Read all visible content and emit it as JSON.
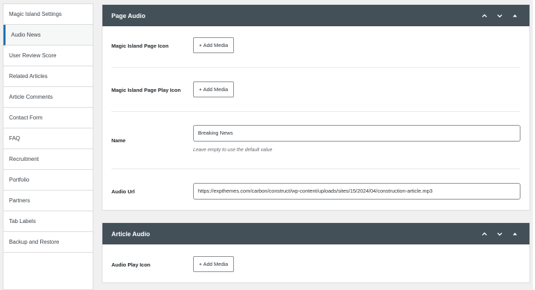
{
  "sidebar": {
    "items": [
      {
        "label": "Magic Island Settings"
      },
      {
        "label": "Audio News"
      },
      {
        "label": "User Review Score"
      },
      {
        "label": "Related Articles"
      },
      {
        "label": "Article Comments"
      },
      {
        "label": "Contact Form"
      },
      {
        "label": "FAQ"
      },
      {
        "label": "Recruitment"
      },
      {
        "label": "Portfolio"
      },
      {
        "label": "Partners"
      },
      {
        "label": "Tab Labels"
      },
      {
        "label": "Backup and Restore"
      }
    ],
    "active_index": 1
  },
  "page_audio": {
    "title": "Page Audio",
    "icons": [
      "chevron-up-icon",
      "chevron-down-icon",
      "triangle-up-icon"
    ],
    "fields": {
      "page_icon": {
        "label": "Magic Island Page Icon",
        "button": "+ Add Media"
      },
      "page_play_icon": {
        "label": "Magic Island Page Play Icon",
        "button": "+ Add Media"
      },
      "name": {
        "label": "Name",
        "value": "Breaking News",
        "hint": "Leave empty to use the default value"
      },
      "audio_url": {
        "label": "Audio Url",
        "value": "https://expthemes.com/carbon/construct/wp-content/uploads/sites/15/2024/04/construction-article.mp3"
      }
    }
  },
  "article_audio": {
    "title": "Article Audio",
    "fields": {
      "play_icon": {
        "label": "Audio Play Icon",
        "button": "+ Add Media"
      }
    }
  },
  "colors": {
    "header_bg": "#435058",
    "accent": "#2271b1",
    "page_bg": "#f0f0f1"
  }
}
